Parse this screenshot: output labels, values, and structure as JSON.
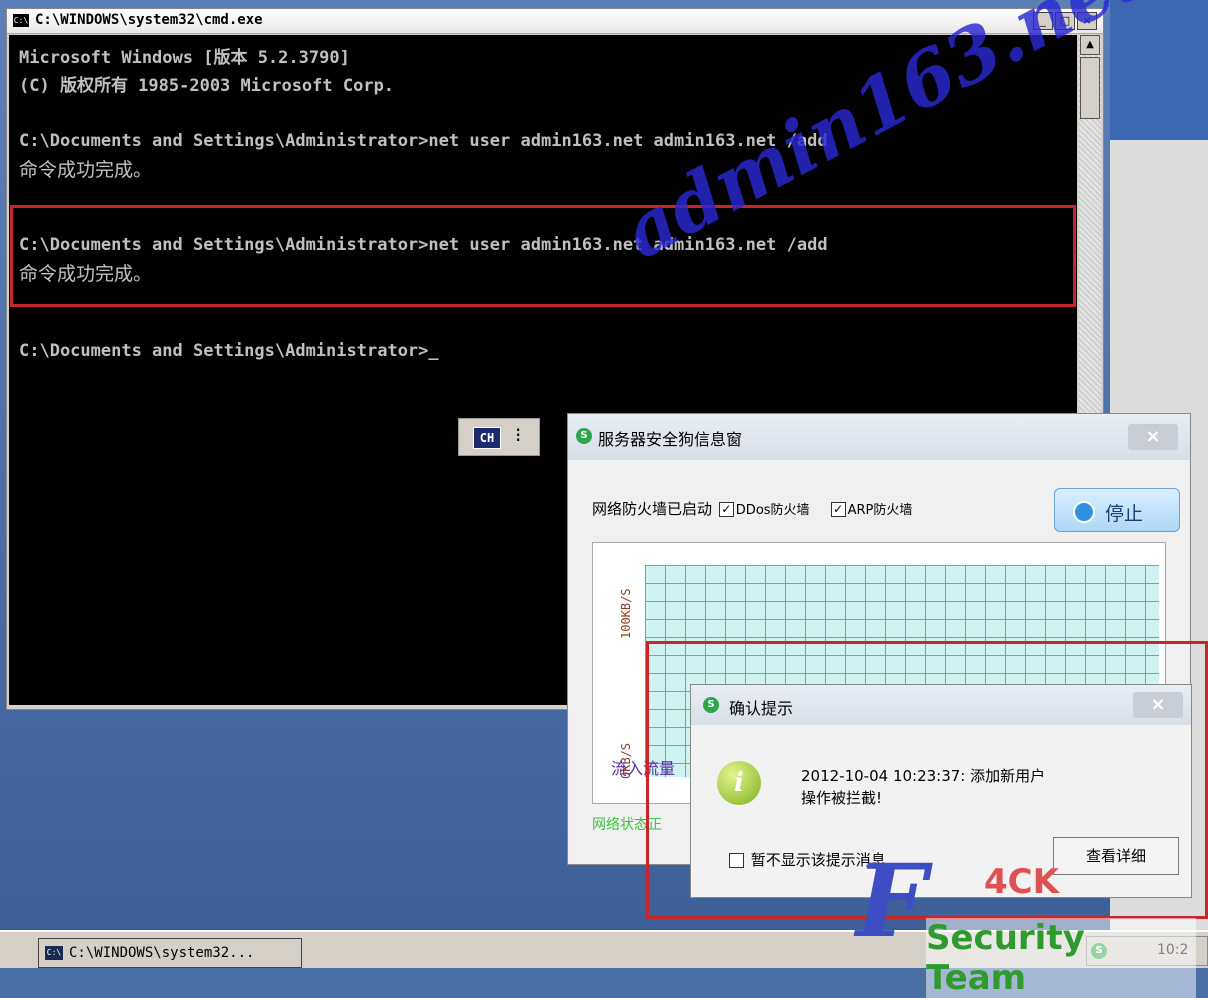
{
  "cmd_window": {
    "title": "C:\\WINDOWS\\system32\\cmd.exe",
    "title_icon": "C:\\",
    "window_buttons": {
      "minimize": "_",
      "maximize": "□",
      "close": "×"
    },
    "lines": [
      "Microsoft Windows [版本 5.2.3790]",
      "(C) 版权所有 1985-2003 Microsoft Corp.",
      "C:\\Documents and Settings\\Administrator>net user admin163.net admin163.net /add",
      "命令成功完成。",
      "C:\\Documents and Settings\\Administrator>net user admin163.net admin163.net /add",
      "命令成功完成。",
      "C:\\Documents and Settings\\Administrator>_"
    ],
    "ime_indicator": "CH"
  },
  "watermark": "admin163.net",
  "security_window": {
    "title": "服务器安全狗信息窗",
    "close": "×",
    "firewall_status": "网络防火墙已启动",
    "ddos_label": "DDos防火墙",
    "ddos_checked": true,
    "arp_label": "ARP防火墙",
    "arp_checked": true,
    "stop_button": "停止",
    "graph_label_top": "100KB/S",
    "graph_label_bottom": "0KB/S",
    "inflow_label": "流入流量",
    "network_status": "网络状态正"
  },
  "confirm_dialog": {
    "title": "确认提示",
    "close": "×",
    "message_line1": "2012-10-04 10:23:37: 添加新用户",
    "message_line2": "操作被拦截!",
    "checkbox_label": "暂不显示该提示消息",
    "checkbox_checked": false,
    "detail_button": "查看详细"
  },
  "taskbar": {
    "task_label": "C:\\WINDOWS\\system32...",
    "clock": "10:2"
  },
  "logo": {
    "letter": "F",
    "text_top": "4CK",
    "text_bottom": "Security Team"
  },
  "colors": {
    "highlight_red": "#c8262b",
    "watermark_blue": "#2828d2",
    "grid_cyan": "#cff3f1"
  }
}
